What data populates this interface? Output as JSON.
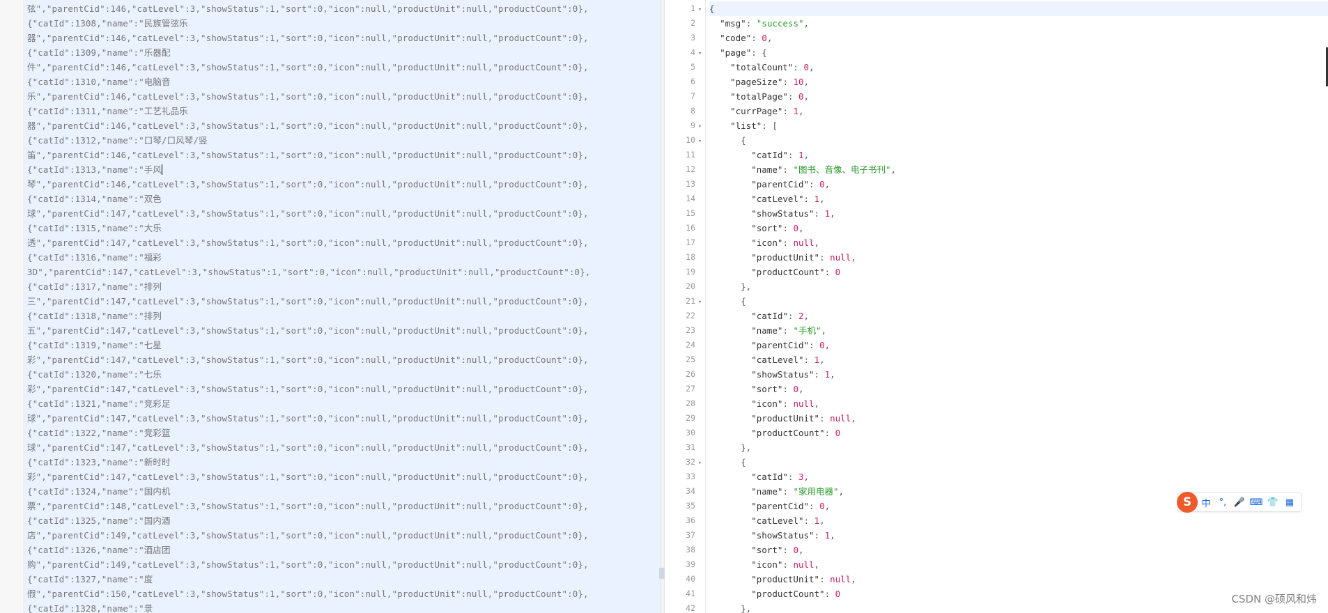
{
  "left_panel": {
    "lines": [
      "弦\",\"parentCid\":146,\"catLevel\":3,\"showStatus\":1,\"sort\":0,\"icon\":null,\"productUnit\":null,\"productCount\":0},",
      "{\"catId\":1308,\"name\":\"民族管弦乐",
      "器\",\"parentCid\":146,\"catLevel\":3,\"showStatus\":1,\"sort\":0,\"icon\":null,\"productUnit\":null,\"productCount\":0},",
      "{\"catId\":1309,\"name\":\"乐器配",
      "件\",\"parentCid\":146,\"catLevel\":3,\"showStatus\":1,\"sort\":0,\"icon\":null,\"productUnit\":null,\"productCount\":0},",
      "{\"catId\":1310,\"name\":\"电脑音",
      "乐\",\"parentCid\":146,\"catLevel\":3,\"showStatus\":1,\"sort\":0,\"icon\":null,\"productUnit\":null,\"productCount\":0},",
      "{\"catId\":1311,\"name\":\"工艺礼品乐",
      "器\",\"parentCid\":146,\"catLevel\":3,\"showStatus\":1,\"sort\":0,\"icon\":null,\"productUnit\":null,\"productCount\":0},",
      "{\"catId\":1312,\"name\":\"口琴/口风琴/竖",
      "笛\",\"parentCid\":146,\"catLevel\":3,\"showStatus\":1,\"sort\":0,\"icon\":null,\"productUnit\":null,\"productCount\":0},",
      "{\"catId\":1313,\"name\":\"手风",
      "琴\",\"parentCid\":146,\"catLevel\":3,\"showStatus\":1,\"sort\":0,\"icon\":null,\"productUnit\":null,\"productCount\":0},",
      "{\"catId\":1314,\"name\":\"双色",
      "球\",\"parentCid\":147,\"catLevel\":3,\"showStatus\":1,\"sort\":0,\"icon\":null,\"productUnit\":null,\"productCount\":0},",
      "{\"catId\":1315,\"name\":\"大乐",
      "透\",\"parentCid\":147,\"catLevel\":3,\"showStatus\":1,\"sort\":0,\"icon\":null,\"productUnit\":null,\"productCount\":0},",
      "{\"catId\":1316,\"name\":\"福彩",
      "3D\",\"parentCid\":147,\"catLevel\":3,\"showStatus\":1,\"sort\":0,\"icon\":null,\"productUnit\":null,\"productCount\":0},",
      "{\"catId\":1317,\"name\":\"排列",
      "三\",\"parentCid\":147,\"catLevel\":3,\"showStatus\":1,\"sort\":0,\"icon\":null,\"productUnit\":null,\"productCount\":0},",
      "{\"catId\":1318,\"name\":\"排列",
      "五\",\"parentCid\":147,\"catLevel\":3,\"showStatus\":1,\"sort\":0,\"icon\":null,\"productUnit\":null,\"productCount\":0},",
      "{\"catId\":1319,\"name\":\"七星",
      "彩\",\"parentCid\":147,\"catLevel\":3,\"showStatus\":1,\"sort\":0,\"icon\":null,\"productUnit\":null,\"productCount\":0},",
      "{\"catId\":1320,\"name\":\"七乐",
      "彩\",\"parentCid\":147,\"catLevel\":3,\"showStatus\":1,\"sort\":0,\"icon\":null,\"productUnit\":null,\"productCount\":0},",
      "{\"catId\":1321,\"name\":\"竞彩足",
      "球\",\"parentCid\":147,\"catLevel\":3,\"showStatus\":1,\"sort\":0,\"icon\":null,\"productUnit\":null,\"productCount\":0},",
      "{\"catId\":1322,\"name\":\"竞彩篮",
      "球\",\"parentCid\":147,\"catLevel\":3,\"showStatus\":1,\"sort\":0,\"icon\":null,\"productUnit\":null,\"productCount\":0},",
      "{\"catId\":1323,\"name\":\"新时时",
      "彩\",\"parentCid\":147,\"catLevel\":3,\"showStatus\":1,\"sort\":0,\"icon\":null,\"productUnit\":null,\"productCount\":0},",
      "{\"catId\":1324,\"name\":\"国内机",
      "票\",\"parentCid\":148,\"catLevel\":3,\"showStatus\":1,\"sort\":0,\"icon\":null,\"productUnit\":null,\"productCount\":0},",
      "{\"catId\":1325,\"name\":\"国内酒",
      "店\",\"parentCid\":149,\"catLevel\":3,\"showStatus\":1,\"sort\":0,\"icon\":null,\"productUnit\":null,\"productCount\":0},",
      "{\"catId\":1326,\"name\":\"酒店团",
      "购\",\"parentCid\":149,\"catLevel\":3,\"showStatus\":1,\"sort\":0,\"icon\":null,\"productUnit\":null,\"productCount\":0},",
      "{\"catId\":1327,\"name\":\"度",
      "假\",\"parentCid\":150,\"catLevel\":3,\"showStatus\":1,\"sort\":0,\"icon\":null,\"productUnit\":null,\"productCount\":0},",
      "{\"catId\":1328,\"name\":\"景"
    ]
  },
  "right_panel": {
    "lines": [
      {
        "num": "1",
        "fold": true,
        "indent": 0,
        "tokens": [
          [
            "p",
            "{"
          ]
        ]
      },
      {
        "num": "2",
        "fold": false,
        "indent": 1,
        "tokens": [
          [
            "k",
            "\"msg\""
          ],
          [
            "p",
            ": "
          ],
          [
            "s",
            "\"success\""
          ],
          [
            "p",
            ","
          ]
        ]
      },
      {
        "num": "3",
        "fold": false,
        "indent": 1,
        "tokens": [
          [
            "k",
            "\"code\""
          ],
          [
            "p",
            ": "
          ],
          [
            "n",
            "0"
          ],
          [
            "p",
            ","
          ]
        ]
      },
      {
        "num": "4",
        "fold": true,
        "indent": 1,
        "tokens": [
          [
            "k",
            "\"page\""
          ],
          [
            "p",
            ": {"
          ]
        ]
      },
      {
        "num": "5",
        "fold": false,
        "indent": 2,
        "tokens": [
          [
            "k",
            "\"totalCount\""
          ],
          [
            "p",
            ": "
          ],
          [
            "n",
            "0"
          ],
          [
            "p",
            ","
          ]
        ]
      },
      {
        "num": "6",
        "fold": false,
        "indent": 2,
        "tokens": [
          [
            "k",
            "\"pageSize\""
          ],
          [
            "p",
            ": "
          ],
          [
            "n",
            "10"
          ],
          [
            "p",
            ","
          ]
        ]
      },
      {
        "num": "7",
        "fold": false,
        "indent": 2,
        "tokens": [
          [
            "k",
            "\"totalPage\""
          ],
          [
            "p",
            ": "
          ],
          [
            "n",
            "0"
          ],
          [
            "p",
            ","
          ]
        ]
      },
      {
        "num": "8",
        "fold": false,
        "indent": 2,
        "tokens": [
          [
            "k",
            "\"currPage\""
          ],
          [
            "p",
            ": "
          ],
          [
            "n",
            "1"
          ],
          [
            "p",
            ","
          ]
        ]
      },
      {
        "num": "9",
        "fold": true,
        "indent": 2,
        "tokens": [
          [
            "k",
            "\"list\""
          ],
          [
            "p",
            ": ["
          ]
        ]
      },
      {
        "num": "10",
        "fold": true,
        "indent": 3,
        "tokens": [
          [
            "p",
            "{"
          ]
        ]
      },
      {
        "num": "11",
        "fold": false,
        "indent": 4,
        "tokens": [
          [
            "k",
            "\"catId\""
          ],
          [
            "p",
            ": "
          ],
          [
            "n",
            "1"
          ],
          [
            "p",
            ","
          ]
        ]
      },
      {
        "num": "12",
        "fold": false,
        "indent": 4,
        "tokens": [
          [
            "k",
            "\"name\""
          ],
          [
            "p",
            ": "
          ],
          [
            "s",
            "\"图书、音像、电子书刊\""
          ],
          [
            "p",
            ","
          ]
        ]
      },
      {
        "num": "13",
        "fold": false,
        "indent": 4,
        "tokens": [
          [
            "k",
            "\"parentCid\""
          ],
          [
            "p",
            ": "
          ],
          [
            "n",
            "0"
          ],
          [
            "p",
            ","
          ]
        ]
      },
      {
        "num": "14",
        "fold": false,
        "indent": 4,
        "tokens": [
          [
            "k",
            "\"catLevel\""
          ],
          [
            "p",
            ": "
          ],
          [
            "n",
            "1"
          ],
          [
            "p",
            ","
          ]
        ]
      },
      {
        "num": "15",
        "fold": false,
        "indent": 4,
        "tokens": [
          [
            "k",
            "\"showStatus\""
          ],
          [
            "p",
            ": "
          ],
          [
            "n",
            "1"
          ],
          [
            "p",
            ","
          ]
        ]
      },
      {
        "num": "16",
        "fold": false,
        "indent": 4,
        "tokens": [
          [
            "k",
            "\"sort\""
          ],
          [
            "p",
            ": "
          ],
          [
            "n",
            "0"
          ],
          [
            "p",
            ","
          ]
        ]
      },
      {
        "num": "17",
        "fold": false,
        "indent": 4,
        "tokens": [
          [
            "k",
            "\"icon\""
          ],
          [
            "p",
            ": "
          ],
          [
            "nl",
            "null"
          ],
          [
            "p",
            ","
          ]
        ]
      },
      {
        "num": "18",
        "fold": false,
        "indent": 4,
        "tokens": [
          [
            "k",
            "\"productUnit\""
          ],
          [
            "p",
            ": "
          ],
          [
            "nl",
            "null"
          ],
          [
            "p",
            ","
          ]
        ]
      },
      {
        "num": "19",
        "fold": false,
        "indent": 4,
        "tokens": [
          [
            "k",
            "\"productCount\""
          ],
          [
            "p",
            ": "
          ],
          [
            "n",
            "0"
          ]
        ]
      },
      {
        "num": "20",
        "fold": false,
        "indent": 3,
        "tokens": [
          [
            "p",
            "},"
          ]
        ]
      },
      {
        "num": "21",
        "fold": true,
        "indent": 3,
        "tokens": [
          [
            "p",
            "{"
          ]
        ]
      },
      {
        "num": "22",
        "fold": false,
        "indent": 4,
        "tokens": [
          [
            "k",
            "\"catId\""
          ],
          [
            "p",
            ": "
          ],
          [
            "n",
            "2"
          ],
          [
            "p",
            ","
          ]
        ]
      },
      {
        "num": "23",
        "fold": false,
        "indent": 4,
        "tokens": [
          [
            "k",
            "\"name\""
          ],
          [
            "p",
            ": "
          ],
          [
            "s",
            "\"手机\""
          ],
          [
            "p",
            ","
          ]
        ]
      },
      {
        "num": "24",
        "fold": false,
        "indent": 4,
        "tokens": [
          [
            "k",
            "\"parentCid\""
          ],
          [
            "p",
            ": "
          ],
          [
            "n",
            "0"
          ],
          [
            "p",
            ","
          ]
        ]
      },
      {
        "num": "25",
        "fold": false,
        "indent": 4,
        "tokens": [
          [
            "k",
            "\"catLevel\""
          ],
          [
            "p",
            ": "
          ],
          [
            "n",
            "1"
          ],
          [
            "p",
            ","
          ]
        ]
      },
      {
        "num": "26",
        "fold": false,
        "indent": 4,
        "tokens": [
          [
            "k",
            "\"showStatus\""
          ],
          [
            "p",
            ": "
          ],
          [
            "n",
            "1"
          ],
          [
            "p",
            ","
          ]
        ]
      },
      {
        "num": "27",
        "fold": false,
        "indent": 4,
        "tokens": [
          [
            "k",
            "\"sort\""
          ],
          [
            "p",
            ": "
          ],
          [
            "n",
            "0"
          ],
          [
            "p",
            ","
          ]
        ]
      },
      {
        "num": "28",
        "fold": false,
        "indent": 4,
        "tokens": [
          [
            "k",
            "\"icon\""
          ],
          [
            "p",
            ": "
          ],
          [
            "nl",
            "null"
          ],
          [
            "p",
            ","
          ]
        ]
      },
      {
        "num": "29",
        "fold": false,
        "indent": 4,
        "tokens": [
          [
            "k",
            "\"productUnit\""
          ],
          [
            "p",
            ": "
          ],
          [
            "nl",
            "null"
          ],
          [
            "p",
            ","
          ]
        ]
      },
      {
        "num": "30",
        "fold": false,
        "indent": 4,
        "tokens": [
          [
            "k",
            "\"productCount\""
          ],
          [
            "p",
            ": "
          ],
          [
            "n",
            "0"
          ]
        ]
      },
      {
        "num": "31",
        "fold": false,
        "indent": 3,
        "tokens": [
          [
            "p",
            "},"
          ]
        ]
      },
      {
        "num": "32",
        "fold": true,
        "indent": 3,
        "tokens": [
          [
            "p",
            "{"
          ]
        ]
      },
      {
        "num": "33",
        "fold": false,
        "indent": 4,
        "tokens": [
          [
            "k",
            "\"catId\""
          ],
          [
            "p",
            ": "
          ],
          [
            "n",
            "3"
          ],
          [
            "p",
            ","
          ]
        ]
      },
      {
        "num": "34",
        "fold": false,
        "indent": 4,
        "tokens": [
          [
            "k",
            "\"name\""
          ],
          [
            "p",
            ": "
          ],
          [
            "s",
            "\"家用电器\""
          ],
          [
            "p",
            ","
          ]
        ]
      },
      {
        "num": "35",
        "fold": false,
        "indent": 4,
        "tokens": [
          [
            "k",
            "\"parentCid\""
          ],
          [
            "p",
            ": "
          ],
          [
            "n",
            "0"
          ],
          [
            "p",
            ","
          ]
        ]
      },
      {
        "num": "36",
        "fold": false,
        "indent": 4,
        "tokens": [
          [
            "k",
            "\"catLevel\""
          ],
          [
            "p",
            ": "
          ],
          [
            "n",
            "1"
          ],
          [
            "p",
            ","
          ]
        ]
      },
      {
        "num": "37",
        "fold": false,
        "indent": 4,
        "tokens": [
          [
            "k",
            "\"showStatus\""
          ],
          [
            "p",
            ": "
          ],
          [
            "n",
            "1"
          ],
          [
            "p",
            ","
          ]
        ]
      },
      {
        "num": "38",
        "fold": false,
        "indent": 4,
        "tokens": [
          [
            "k",
            "\"sort\""
          ],
          [
            "p",
            ": "
          ],
          [
            "n",
            "0"
          ],
          [
            "p",
            ","
          ]
        ]
      },
      {
        "num": "39",
        "fold": false,
        "indent": 4,
        "tokens": [
          [
            "k",
            "\"icon\""
          ],
          [
            "p",
            ": "
          ],
          [
            "nl",
            "null"
          ],
          [
            "p",
            ","
          ]
        ]
      },
      {
        "num": "40",
        "fold": false,
        "indent": 4,
        "tokens": [
          [
            "k",
            "\"productUnit\""
          ],
          [
            "p",
            ": "
          ],
          [
            "nl",
            "null"
          ],
          [
            "p",
            ","
          ]
        ]
      },
      {
        "num": "41",
        "fold": false,
        "indent": 4,
        "tokens": [
          [
            "k",
            "\"productCount\""
          ],
          [
            "p",
            ": "
          ],
          [
            "n",
            "0"
          ]
        ]
      },
      {
        "num": "42",
        "fold": false,
        "indent": 3,
        "tokens": [
          [
            "p",
            "},"
          ]
        ]
      }
    ]
  },
  "ime_toolbar": {
    "logo": "S",
    "items": [
      {
        "icon": "chinese-mode-icon",
        "glyph": "中"
      },
      {
        "icon": "punctuation-icon",
        "glyph": "°,"
      },
      {
        "icon": "microphone-icon",
        "glyph": "🎤"
      },
      {
        "icon": "keyboard-icon",
        "glyph": "⌨"
      },
      {
        "icon": "skin-shirt-icon",
        "glyph": "👕"
      },
      {
        "icon": "apps-grid-icon",
        "glyph": "▦"
      }
    ]
  },
  "watermark": "CSDN @硕风和炜",
  "colors": {
    "left_bg": "#eaf2ff",
    "string": "#2a9a2a",
    "number": "#c81e61",
    "ime_logo": "#ef5a2a",
    "ime_icons": "#1565d8"
  }
}
